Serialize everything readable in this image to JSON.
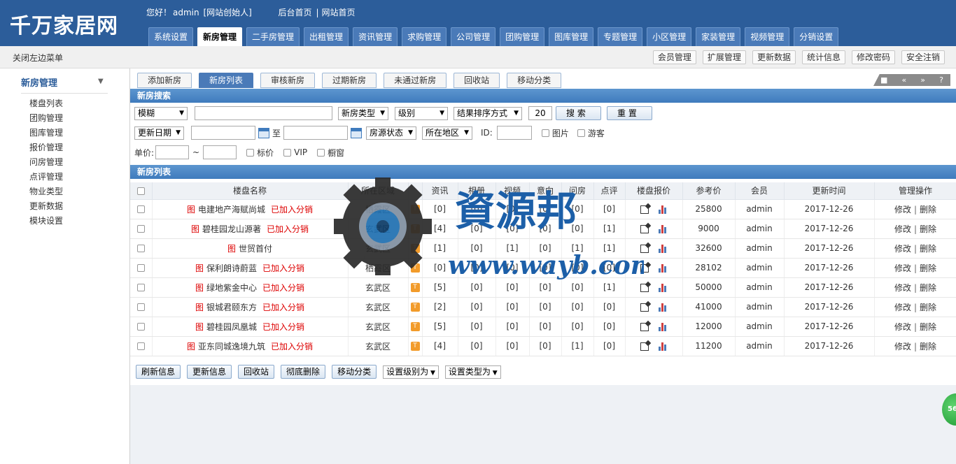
{
  "header": {
    "logo": "千万家居网",
    "welcome_prefix": "您好！",
    "username": "admin",
    "role": "[网站创始人]",
    "links": [
      "后台首页",
      "网站首页"
    ],
    "separator": "|",
    "tabs": [
      {
        "label": "系统设置",
        "active": false
      },
      {
        "label": "新房管理",
        "active": true
      },
      {
        "label": "二手房管理",
        "active": false
      },
      {
        "label": "出租管理",
        "active": false
      },
      {
        "label": "资讯管理",
        "active": false
      },
      {
        "label": "求购管理",
        "active": false
      },
      {
        "label": "公司管理",
        "active": false
      },
      {
        "label": "团购管理",
        "active": false
      },
      {
        "label": "图库管理",
        "active": false
      },
      {
        "label": "专题管理",
        "active": false
      },
      {
        "label": "小区管理",
        "active": false
      },
      {
        "label": "家装管理",
        "active": false
      },
      {
        "label": "视频管理",
        "active": false
      },
      {
        "label": "分销设置",
        "active": false
      }
    ]
  },
  "subbar": {
    "close_left": "关闭左边菜单",
    "buttons": [
      "会员管理",
      "扩展管理",
      "更新数据",
      "统计信息",
      "修改密码",
      "安全注销"
    ]
  },
  "sidebar": {
    "title": "新房管理",
    "arrow": "▼",
    "items": [
      "楼盘列表",
      "团购管理",
      "图库管理",
      "报价管理",
      "问房管理",
      "点评管理",
      "物业类型",
      "更新数据",
      "模块设置"
    ]
  },
  "subtabs": [
    {
      "label": "添加新房",
      "active": false
    },
    {
      "label": "新房列表",
      "active": true
    },
    {
      "label": "审核新房",
      "active": false
    },
    {
      "label": "过期新房",
      "active": false
    },
    {
      "label": "未通过新房",
      "active": false
    },
    {
      "label": "回收站",
      "active": false
    },
    {
      "label": "移动分类",
      "active": false
    }
  ],
  "tool_icons": [
    "■",
    "«",
    "»",
    "?"
  ],
  "search": {
    "section_title": "新房搜索",
    "match_mode": "模糊",
    "keyword_value": "",
    "type_select": "新房类型",
    "level_select": "级别",
    "sort_select": "结果排序方式",
    "page_size": "20",
    "search_btn": "搜 索",
    "reset_btn": "重 置",
    "date_select": "更新日期",
    "date_from": "",
    "to_label": "至",
    "date_to": "",
    "status_select": "房源状态",
    "region_select": "所在地区",
    "id_label": "ID:",
    "id_value": "",
    "chk_pic": "图片",
    "chk_guest": "游客",
    "price_label": "单价:",
    "price_from": "",
    "tilde": "~",
    "price_to": "",
    "chk_price": "标价",
    "chk_vip": "VIP",
    "chk_window": "橱窗"
  },
  "list": {
    "section_title": "新房列表",
    "columns": [
      "",
      "楼盘名称",
      "所在区域",
      "",
      "资讯",
      "相册",
      "视频",
      "意向",
      "问房",
      "点评",
      "楼盘报价",
      "参考价",
      "会员",
      "更新时间",
      "管理操作"
    ],
    "pic_tag": "图",
    "dist_tag": "已加入分销",
    "edit_label": "修改",
    "delete_label": "删除",
    "op_sep": "|",
    "badge_text": "T",
    "rows": [
      {
        "name": "电建地产海赋尚城",
        "dist": true,
        "area": "栖霞区",
        "news": "[0]",
        "album": "[0]",
        "video": "[0]",
        "intent": "[0]",
        "ask": "[0]",
        "review": "[0]",
        "price": "25800",
        "member": "admin",
        "time": "2017-12-26"
      },
      {
        "name": "碧桂园龙山源著",
        "dist": true,
        "area": "玄武区",
        "news": "[4]",
        "album": "[0]",
        "video": "[0]",
        "intent": "[0]",
        "ask": "[0]",
        "review": "[1]",
        "price": "9000",
        "member": "admin",
        "time": "2017-12-26"
      },
      {
        "name": "世贸首付",
        "dist": false,
        "area": "玄武区",
        "news": "[1]",
        "album": "[0]",
        "video": "[1]",
        "intent": "[0]",
        "ask": "[1]",
        "review": "[1]",
        "price": "32600",
        "member": "admin",
        "time": "2017-12-26"
      },
      {
        "name": "保利朗诗蔚蓝",
        "dist": true,
        "area": "栖霞区",
        "news": "[0]",
        "album": "[0]",
        "video": "[0]",
        "intent": "[0]",
        "ask": "[0]",
        "review": "[0]",
        "price": "28102",
        "member": "admin",
        "time": "2017-12-26"
      },
      {
        "name": "绿地紫金中心",
        "dist": true,
        "area": "玄武区",
        "news": "[5]",
        "album": "[0]",
        "video": "[0]",
        "intent": "[0]",
        "ask": "[0]",
        "review": "[1]",
        "price": "50000",
        "member": "admin",
        "time": "2017-12-26"
      },
      {
        "name": "银城君颐东方",
        "dist": true,
        "area": "玄武区",
        "news": "[2]",
        "album": "[0]",
        "video": "[0]",
        "intent": "[0]",
        "ask": "[0]",
        "review": "[0]",
        "price": "41000",
        "member": "admin",
        "time": "2017-12-26"
      },
      {
        "name": "碧桂园凤凰城",
        "dist": true,
        "area": "玄武区",
        "news": "[5]",
        "album": "[0]",
        "video": "[0]",
        "intent": "[0]",
        "ask": "[0]",
        "review": "[0]",
        "price": "12000",
        "member": "admin",
        "time": "2017-12-26"
      },
      {
        "name": "亚东同城逸境九筑",
        "dist": true,
        "area": "玄武区",
        "news": "[4]",
        "album": "[0]",
        "video": "[0]",
        "intent": "[0]",
        "ask": "[1]",
        "review": "[0]",
        "price": "11200",
        "member": "admin",
        "time": "2017-12-26"
      }
    ]
  },
  "bottom": {
    "buttons": [
      "刷新信息",
      "更新信息",
      "回收站",
      "彻底删除",
      "移动分类"
    ],
    "selects": [
      "设置级别为",
      "设置类型为"
    ]
  },
  "watermark": {
    "title": "資源邦",
    "url": "www.wayb.com"
  },
  "float_ball": "56",
  "colors": {
    "header": "#2c5d9a",
    "accent": "#4a7ab8",
    "tag_red": "#dd0000"
  }
}
